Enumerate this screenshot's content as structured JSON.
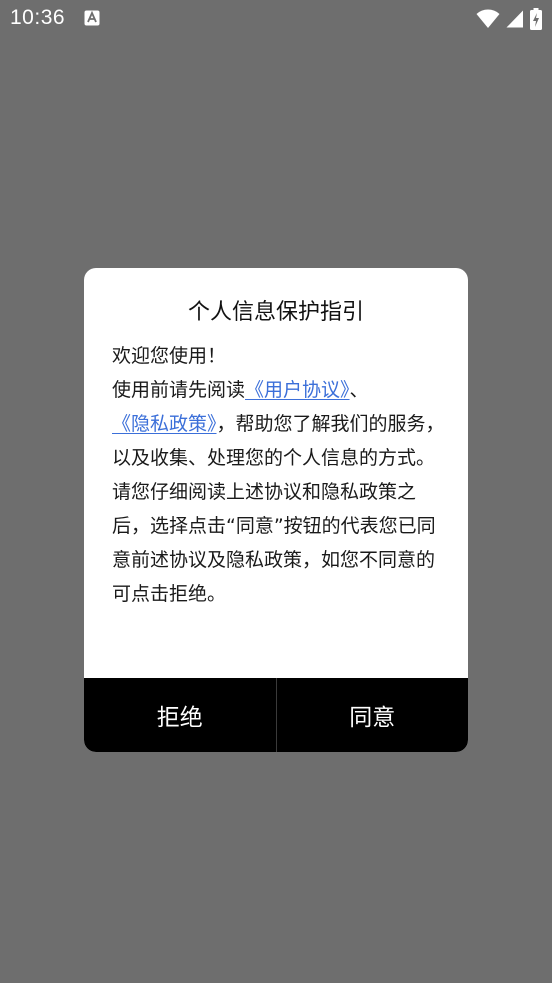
{
  "status_bar": {
    "time": "10:36",
    "notification_icon": "text-notification-icon",
    "wifi_icon": "wifi-icon",
    "signal_icon": "cell-signal-icon",
    "battery_icon": "battery-charging-icon"
  },
  "dialog": {
    "title": "个人信息保护指引",
    "welcome": "欢迎您使用！",
    "read_prefix": "使用前请先阅读",
    "user_agreement_link": "《用户协议》",
    "separator": "、",
    "privacy_policy_link": "《隐私政策》",
    "read_suffix": "，帮助您了解我们的服务，以及收集、处理您的个人信息的方式。",
    "consent_text": "请您仔细阅读上述协议和隐私政策之后，选择点击“同意”按钮的代表您已同意前述协议及隐私政策，如您不同意的可点击拒绝。",
    "reject_button": "拒绝",
    "agree_button": "同意"
  },
  "colors": {
    "backdrop": "#6e6e6e",
    "dialog_background": "#ffffff",
    "link": "#3b6fd9",
    "button_bar": "#000000"
  }
}
